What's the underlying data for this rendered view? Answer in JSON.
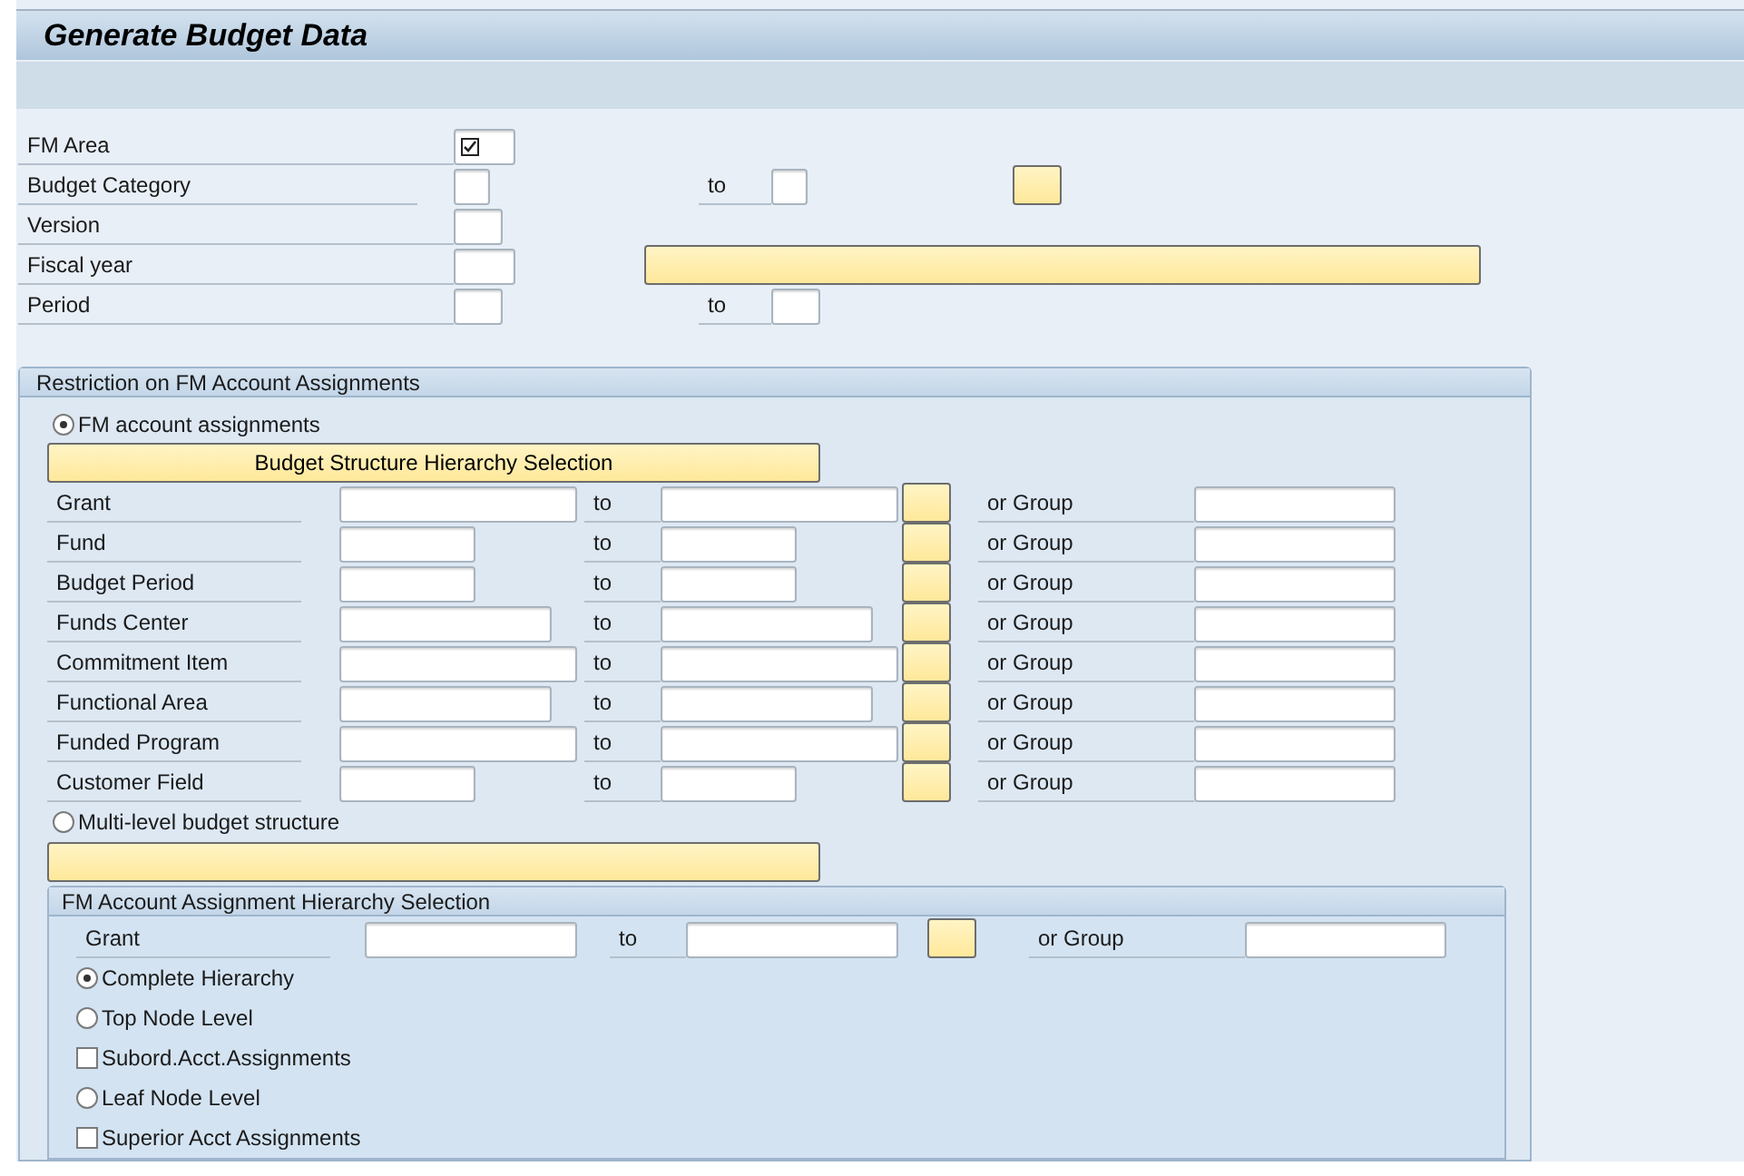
{
  "window": {
    "title": "Generate Budget Data"
  },
  "header_fields": [
    {
      "label": "FM Area",
      "kind": "required"
    },
    {
      "label": "Budget Category",
      "kind": "range_multi",
      "to_label": "to"
    },
    {
      "label": "Version",
      "kind": "single"
    },
    {
      "label": "Fiscal year",
      "kind": "single_bar"
    },
    {
      "label": "Period",
      "kind": "range",
      "to_label": "to"
    }
  ],
  "restriction": {
    "title": "Restriction on FM Account Assignments",
    "mode_options": [
      {
        "label": "FM account assignments",
        "selected": true
      },
      {
        "label": "Multi-level budget structure",
        "selected": false
      }
    ],
    "hierarchy_button": {
      "label": "Budget Structure Hierarchy Selection"
    },
    "rows": [
      {
        "label": "Grant",
        "to_label": "to",
        "group_label": "or Group"
      },
      {
        "label": "Fund",
        "to_label": "to",
        "group_label": "or Group"
      },
      {
        "label": "Budget Period",
        "to_label": "to",
        "group_label": "or Group"
      },
      {
        "label": "Funds Center",
        "to_label": "to",
        "group_label": "or Group"
      },
      {
        "label": "Commitment Item",
        "to_label": "to",
        "group_label": "or Group"
      },
      {
        "label": "Functional Area",
        "to_label": "to",
        "group_label": "or Group"
      },
      {
        "label": "Funded Program",
        "to_label": "to",
        "group_label": "or Group"
      },
      {
        "label": "Customer Field",
        "to_label": "to",
        "group_label": "or Group"
      }
    ],
    "hierarchy_panel": {
      "title": "FM Account Assignment Hierarchy Selection",
      "rows": [
        {
          "label": "Grant",
          "to_label": "to",
          "group_label": "or Group"
        }
      ],
      "options": [
        {
          "kind": "radio",
          "label": "Complete Hierarchy",
          "selected": true
        },
        {
          "kind": "radio",
          "label": "Top Node Level",
          "selected": false
        },
        {
          "kind": "checkbox",
          "label": "Subord.Acct.Assignments",
          "checked": false
        },
        {
          "kind": "radio",
          "label": "Leaf Node Level",
          "selected": false
        },
        {
          "kind": "checkbox",
          "label": "Superior Acct Assignments",
          "checked": false
        }
      ]
    }
  }
}
